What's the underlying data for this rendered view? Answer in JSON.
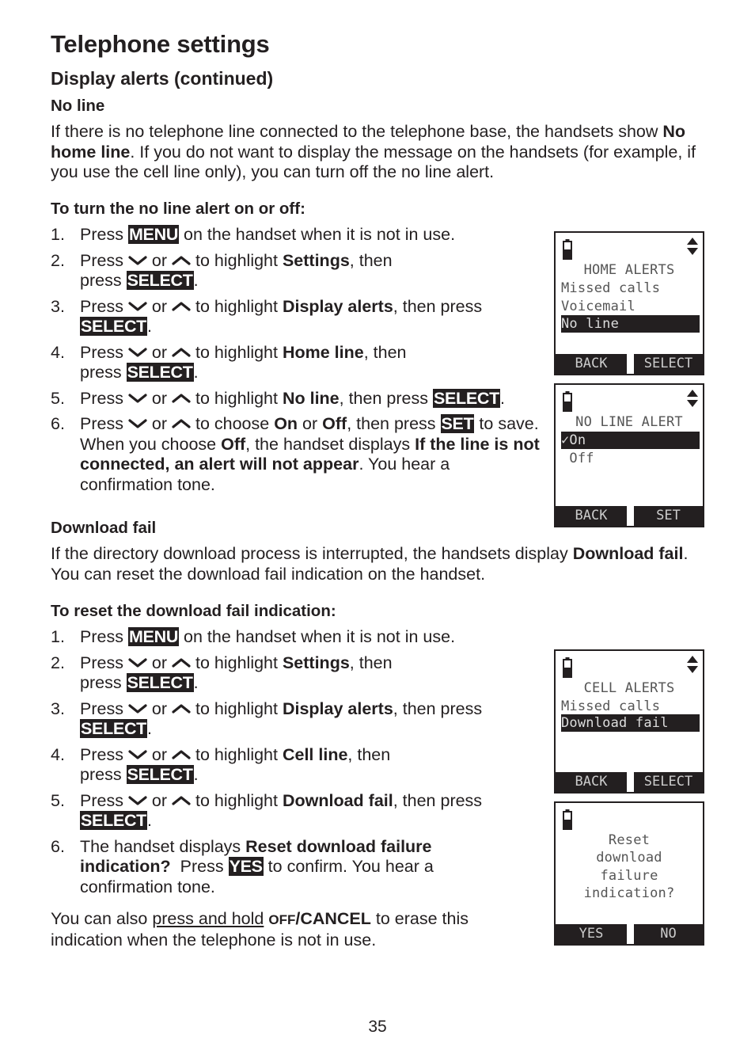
{
  "page": {
    "title": "Telephone settings",
    "subtitle": "Display alerts (continued)",
    "page_number": "35"
  },
  "no_line": {
    "heading": "No line",
    "para_1": "If there is no telephone line connected to the telephone base, the handsets show ",
    "para_bold": "No home line",
    "para_2": ". If you do not want to display the message on the handsets (for example, if you use the cell line only), you can turn off the no line alert.",
    "steps_heading": "To turn the no line alert on or off:",
    "steps": [
      {
        "num": "1.",
        "t1": "Press ",
        "key": "MENU",
        "t2": " on the handset when it is not in use."
      },
      {
        "num": "2.",
        "t1": "Press ",
        "or": " or ",
        "t2": " to highlight ",
        "bold": "Settings",
        "t3": ", then press ",
        "key": "SELECT",
        "t4": "."
      },
      {
        "num": "3.",
        "t1": "Press ",
        "or": " or ",
        "t2": " to highlight ",
        "bold": "Display alerts",
        "t3": ", then press ",
        "key": "SELECT",
        "t4": "."
      },
      {
        "num": "4.",
        "t1": "Press ",
        "or": " or ",
        "t2": " to highlight ",
        "bold": "Home line",
        "t3": ", then press ",
        "key": "SELECT",
        "t4": "."
      },
      {
        "num": "5.",
        "t1": "Press ",
        "or": " or ",
        "t2": " to highlight ",
        "bold": "No line",
        "t3": ", then press ",
        "key": "SELECT",
        "t4": "."
      },
      {
        "num": "6.",
        "t1": "Press ",
        "or": " or ",
        "t2": " to choose ",
        "bold": "On",
        "t2b": " or ",
        "bold2": "Off",
        "t3": ", then press ",
        "key": "SET",
        "t4": " to save. When you choose ",
        "bold3": "Off",
        "t5": ", the handset displays ",
        "bold4": "If the line is not connected, an alert will not appear",
        "t6": ". You hear a confirmation tone."
      }
    ]
  },
  "download_fail": {
    "heading": "Download fail",
    "para_1": "If the directory download process is interrupted, the handsets display ",
    "para_bold": "Download fail",
    "para_2": ". You can reset the download fail indication on the handset.",
    "steps_heading": "To reset the download fail indication:",
    "steps": [
      {
        "num": "1.",
        "t1": "Press ",
        "key": "MENU",
        "t2": " on the handset when it is not in use."
      },
      {
        "num": "2.",
        "t1": "Press ",
        "or": " or ",
        "t2": " to highlight ",
        "bold": "Settings",
        "t3": ", then press ",
        "key": "SELECT",
        "t4": "."
      },
      {
        "num": "3.",
        "t1": "Press ",
        "or": " or ",
        "t2": " to highlight ",
        "bold": "Display alerts",
        "t3": ", then press ",
        "key": "SELECT",
        "t4": "."
      },
      {
        "num": "4.",
        "t1": "Press ",
        "or": " or ",
        "t2": " to highlight ",
        "bold": "Cell line",
        "t3": ", then press ",
        "key": "SELECT",
        "t4": "."
      },
      {
        "num": "5.",
        "t1": "Press ",
        "or": " or ",
        "t2": " to highlight ",
        "bold": "Download fail",
        "t3": ", then press ",
        "key": "SELECT",
        "t4": "."
      },
      {
        "num": "6.",
        "t1": "The handset displays ",
        "bold": "Reset download failure indication?",
        "t2": "  Press ",
        "key": "YES",
        "t3": " to confirm. You hear a confirmation tone."
      }
    ],
    "note_1": "You can also ",
    "note_link": "press and hold",
    "note_off": "OFF",
    "note_cancel": "/CANCEL",
    "note_2": " to erase this indication when the telephone is not in use."
  },
  "screens": [
    {
      "title": "HOME ALERTS",
      "items": [
        "Missed calls",
        "Voicemail",
        "No line"
      ],
      "highlighted": 2,
      "softkeys": [
        "BACK",
        "SELECT"
      ],
      "scroll_icon": "up-down-arrows-icon"
    },
    {
      "title": "NO LINE ALERT",
      "items": [
        "✓On",
        " Off"
      ],
      "highlighted": 0,
      "softkeys": [
        "BACK",
        "SET"
      ],
      "scroll_icon": "up-down-arrows-icon"
    },
    {
      "title": "CELL ALERTS",
      "items": [
        "Missed calls",
        "Download fail"
      ],
      "highlighted": 1,
      "softkeys": [
        "BACK",
        "SELECT"
      ],
      "scroll_icon": "up-down-arrows-icon"
    },
    {
      "lines": [
        "Reset",
        "download",
        "failure",
        "indication?"
      ],
      "softkeys": [
        "YES",
        "NO"
      ]
    }
  ]
}
